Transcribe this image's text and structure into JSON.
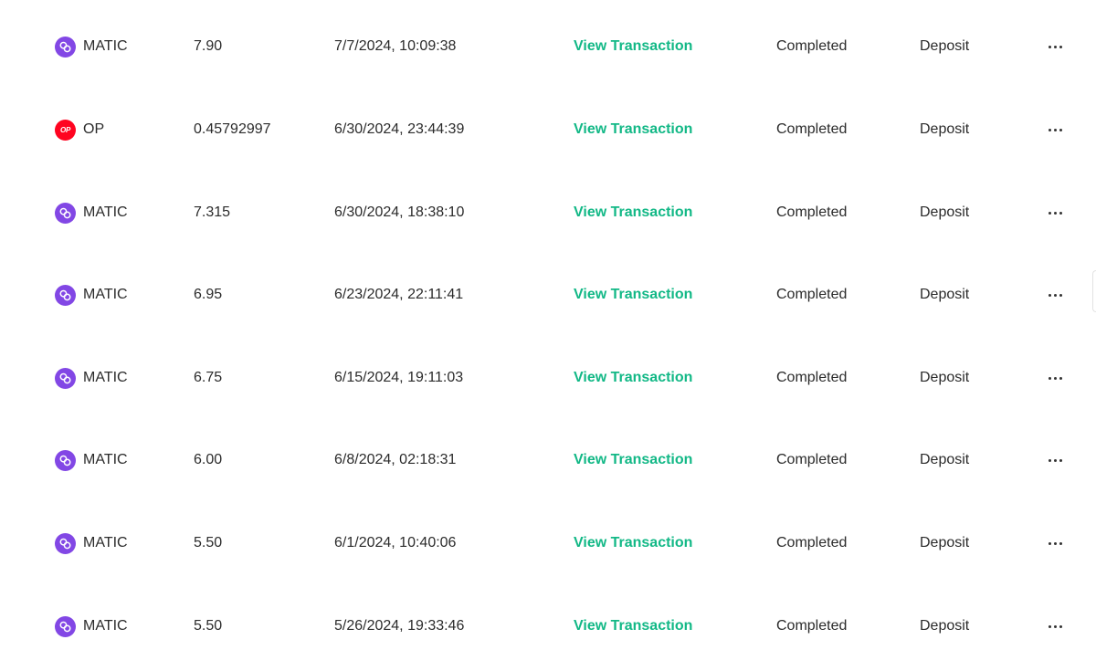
{
  "colors": {
    "matic": "#8247e5",
    "op": "#ff0420",
    "link": "#12b886"
  },
  "transactions": [
    {
      "asset": "MATIC",
      "icon": "polygon-icon",
      "amount": "7.90",
      "date": "7/7/2024, 10:09:38",
      "link": "View Transaction",
      "status": "Completed",
      "type": "Deposit"
    },
    {
      "asset": "OP",
      "icon": "optimism-icon",
      "icon_text": "OP",
      "amount": "0.45792997",
      "date": "6/30/2024, 23:44:39",
      "link": "View Transaction",
      "status": "Completed",
      "type": "Deposit"
    },
    {
      "asset": "MATIC",
      "icon": "polygon-icon",
      "amount": "7.315",
      "date": "6/30/2024, 18:38:10",
      "link": "View Transaction",
      "status": "Completed",
      "type": "Deposit"
    },
    {
      "asset": "MATIC",
      "icon": "polygon-icon",
      "amount": "6.95",
      "date": "6/23/2024, 22:11:41",
      "link": "View Transaction",
      "status": "Completed",
      "type": "Deposit"
    },
    {
      "asset": "MATIC",
      "icon": "polygon-icon",
      "amount": "6.75",
      "date": "6/15/2024, 19:11:03",
      "link": "View Transaction",
      "status": "Completed",
      "type": "Deposit"
    },
    {
      "asset": "MATIC",
      "icon": "polygon-icon",
      "amount": "6.00",
      "date": "6/8/2024, 02:18:31",
      "link": "View Transaction",
      "status": "Completed",
      "type": "Deposit"
    },
    {
      "asset": "MATIC",
      "icon": "polygon-icon",
      "amount": "5.50",
      "date": "6/1/2024, 10:40:06",
      "link": "View Transaction",
      "status": "Completed",
      "type": "Deposit"
    },
    {
      "asset": "MATIC",
      "icon": "polygon-icon",
      "amount": "5.50",
      "date": "5/26/2024, 19:33:46",
      "link": "View Transaction",
      "status": "Completed",
      "type": "Deposit"
    }
  ]
}
